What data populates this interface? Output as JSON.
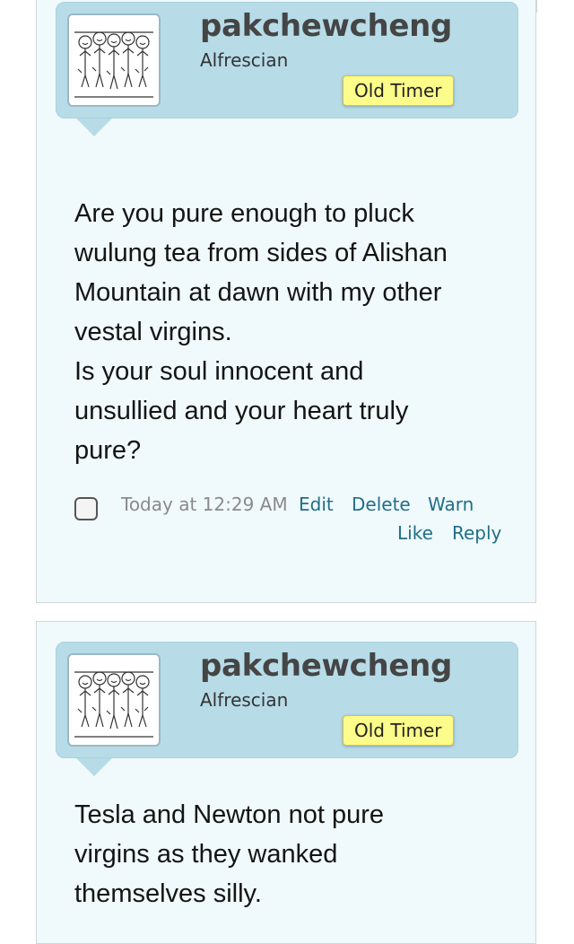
{
  "posts": [
    {
      "username": "pakchewcheng",
      "user_title": "Alfrescian",
      "badge": "Old Timer",
      "message_lines": [
        "Are you pure enough to pluck",
        "wulung tea from sides of Alishan",
        "Mountain at dawn with my other",
        "vestal virgins.",
        "Is your soul innocent and",
        "unsullied and your heart truly",
        "pure?"
      ],
      "date": "Today at 12:29 AM",
      "actions": {
        "edit": "Edit",
        "delete": "Delete",
        "warn": "Warn",
        "like": "Like",
        "reply": "Reply"
      }
    },
    {
      "username": "pakchewcheng",
      "user_title": "Alfrescian",
      "badge": "Old Timer",
      "message_lines": [
        "Tesla and Newton not pure",
        "virgins as they wanked",
        "themselves silly."
      ]
    }
  ]
}
